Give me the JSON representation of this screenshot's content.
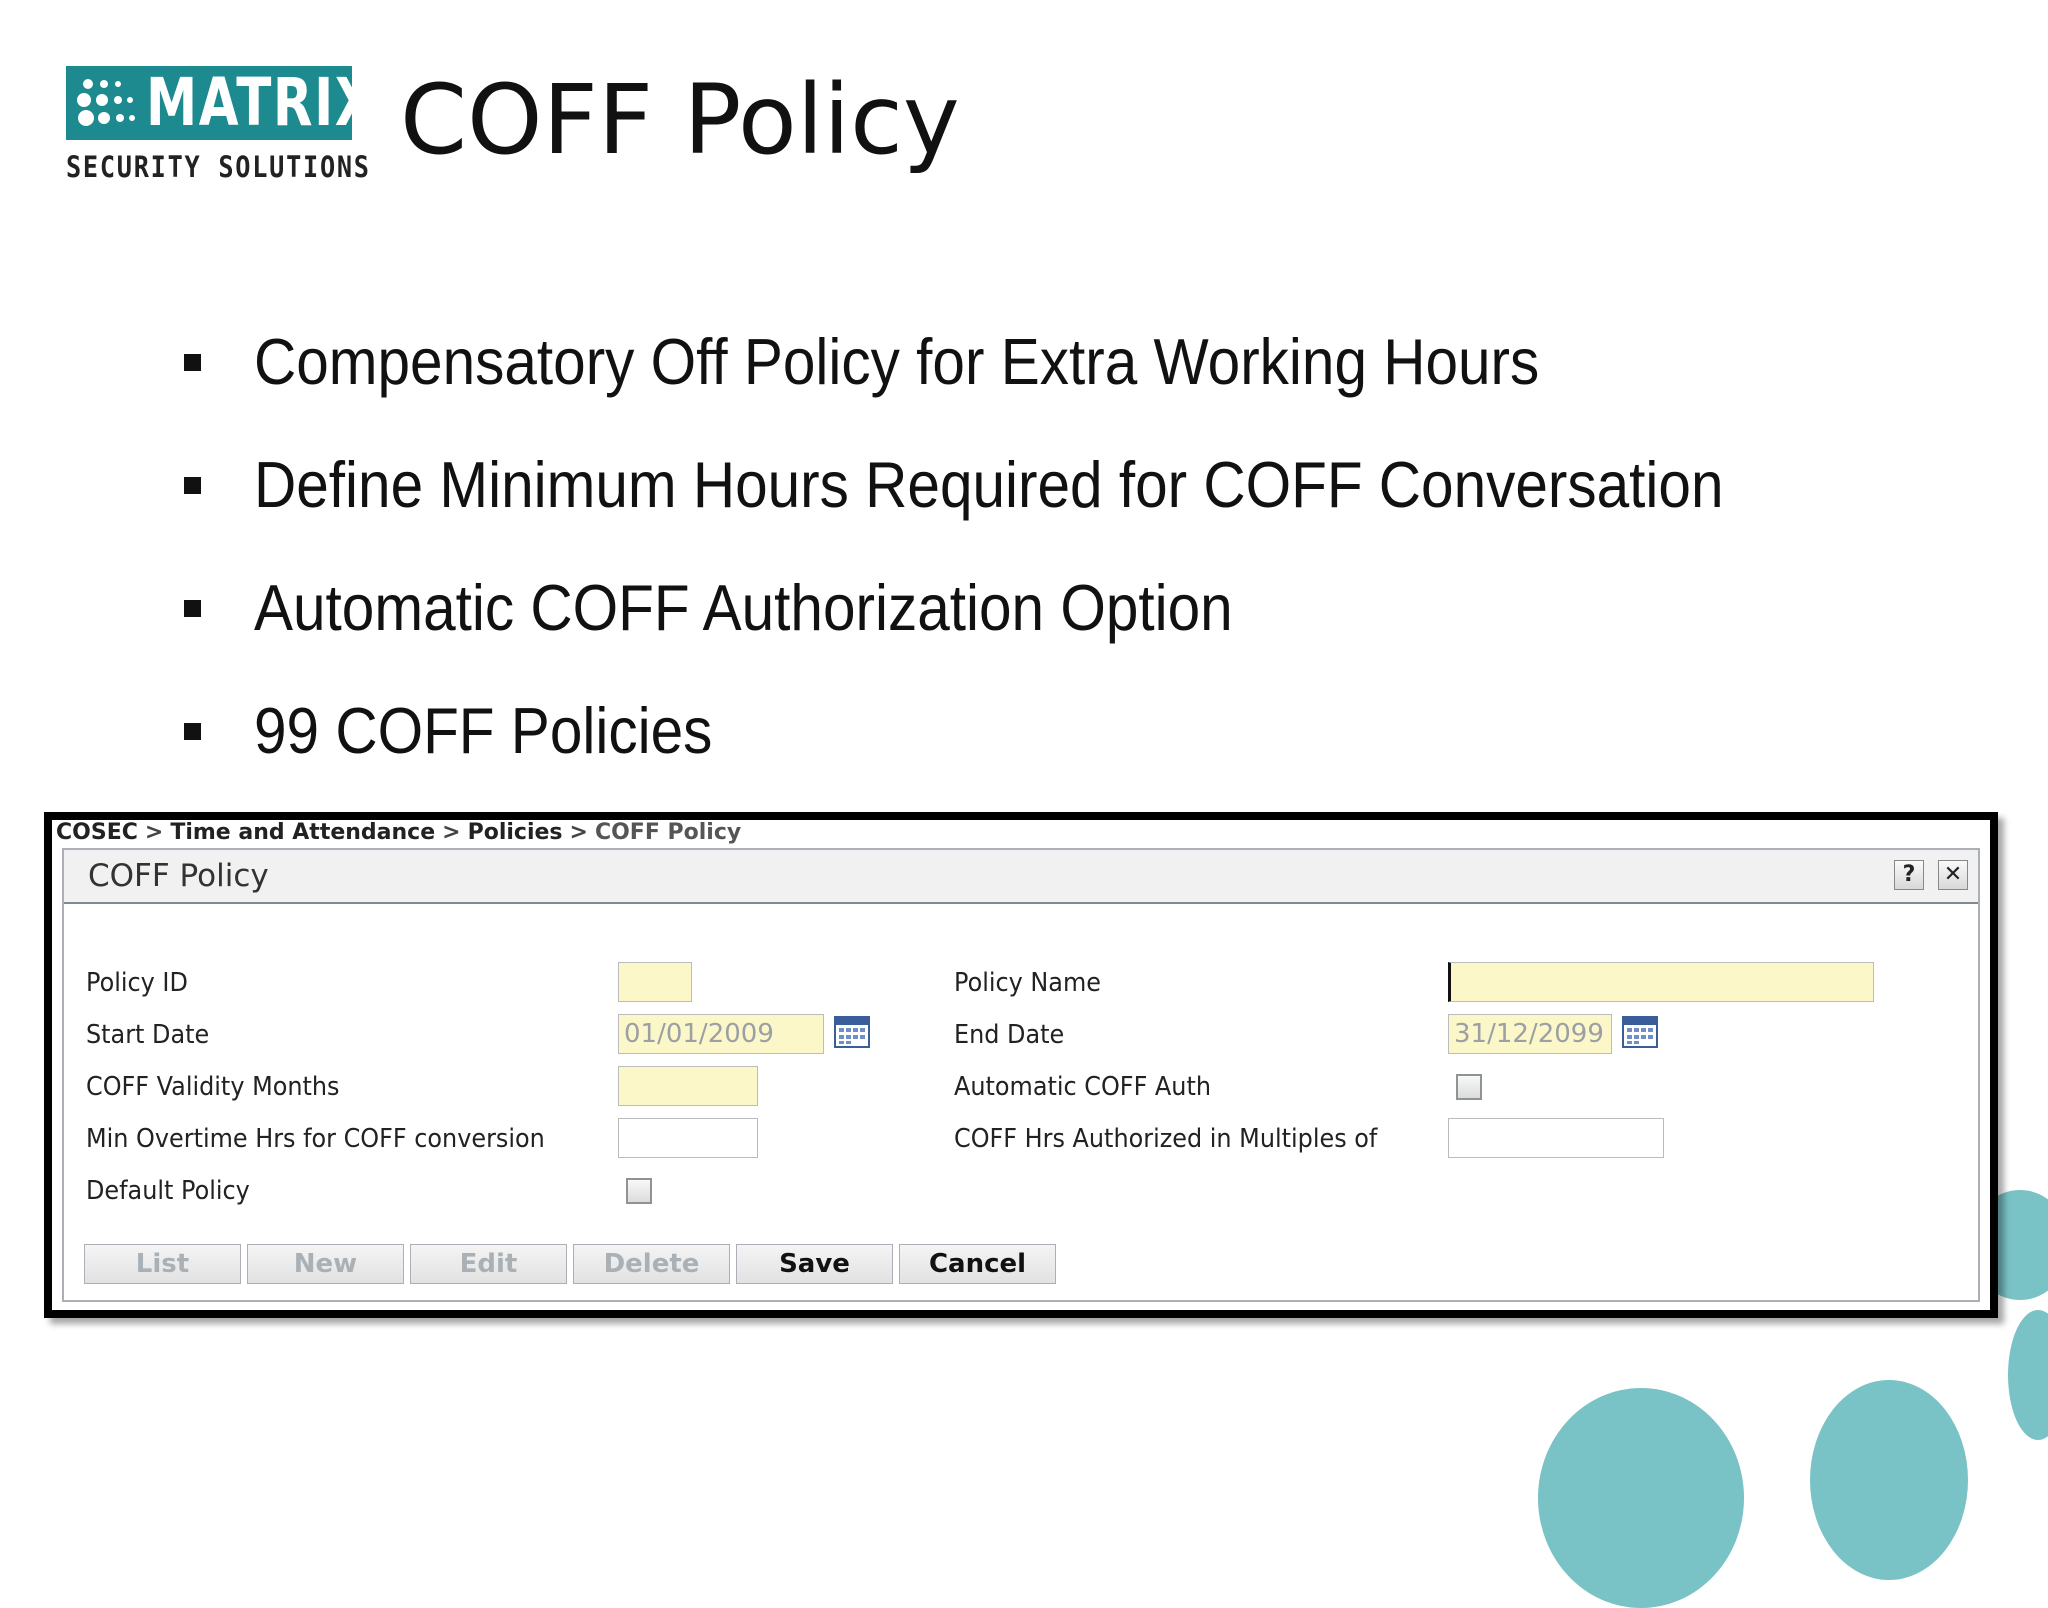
{
  "logo": {
    "wordmark": "MATRIX",
    "tagline": "SECURITY SOLUTIONS"
  },
  "slide": {
    "title": "COFF Policy",
    "bullets": [
      "Compensatory Off  Policy for Extra Working Hours",
      "Define Minimum Hours Required for COFF Conversation",
      "Automatic COFF Authorization Option",
      "99 COFF Policies"
    ]
  },
  "app": {
    "breadcrumb": [
      "COSEC",
      "Time and Attendance",
      "Policies",
      "COFF Policy"
    ],
    "breadcrumb_sep": ">",
    "panel_title": "COFF Policy",
    "help_label": "?",
    "close_label": "✕",
    "form": {
      "policy_id_label": "Policy ID",
      "policy_id_value": "",
      "policy_name_label": "Policy Name",
      "policy_name_value": "",
      "start_date_label": "Start Date",
      "start_date_value": "01/01/2009",
      "end_date_label": "End Date",
      "end_date_value": "31/12/2099",
      "validity_label": "COFF Validity Months",
      "validity_value": "",
      "auto_auth_label": "Automatic COFF Auth",
      "auto_auth_checked": false,
      "min_overtime_label": "Min Overtime Hrs for COFF conversion",
      "min_overtime_value": "",
      "multiples_label": "COFF Hrs Authorized in Multiples of",
      "multiples_value": "",
      "default_policy_label": "Default Policy",
      "default_policy_checked": false
    },
    "buttons": {
      "list": "List",
      "new": "New",
      "edit": "Edit",
      "delete": "Delete",
      "save": "Save",
      "cancel": "Cancel"
    }
  },
  "colors": {
    "brand_teal": "#1d8a8f",
    "decor_teal": "#79c2c6",
    "field_yellow": "#fcf7c8"
  }
}
